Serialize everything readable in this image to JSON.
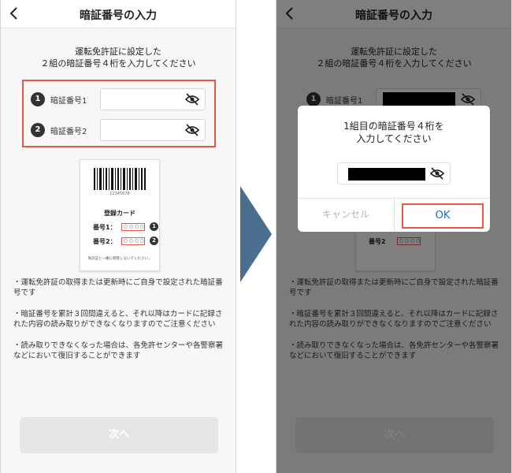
{
  "left": {
    "title": "暗証番号の入力",
    "intro_line1": "運転免許証に設定した",
    "intro_line2": "２組の暗証番号４桁を入力してください",
    "rows": [
      {
        "num": "1",
        "label": "暗証番号1"
      },
      {
        "num": "2",
        "label": "暗証番号2"
      }
    ],
    "card": {
      "barcode_number": "12345678",
      "title": "登録カード",
      "row1_label": "番号1：",
      "row2_label": "番号2：",
      "row1_num": "1",
      "row2_num": "2",
      "note": "免許証と一緒に保管しないでください。"
    },
    "notes": [
      "・運転免許証の取得または更新時にご自身で設定された暗証番号です",
      "・暗証番号を累計３回間違えると、それ以降はカードに記録された内容の読み取りができなくなりますのでご注意ください",
      "・読み取りできなくなった場合は、各免許センターや各警察署などにおいて復旧することができます"
    ],
    "next_label": "次へ"
  },
  "right": {
    "title": "暗証番号の入力",
    "intro_line1": "運転免許証に設定した",
    "intro_line2": "２組の暗証番号４桁を入力してください",
    "row1_num": "1",
    "row1_label": "暗証番号1",
    "row2_label": "番号2",
    "notes": [
      "・運転免許証の取得または更新時にご自身で設定された暗証番号です",
      "・暗証番号を累計３回間違えると、それ以降はカードに記録された内容の読み取りができなくなりますのでご注意ください",
      "・読み取りできなくなった場合は、各免許センターや各警察署などにおいて復旧することができます"
    ],
    "next_label": "次へ",
    "dialog": {
      "line1": "1組目の暗証番号４桁を",
      "line2": "入力してください",
      "cancel": "キャンセル",
      "ok": "OK"
    }
  },
  "colors": {
    "highlight": "#e05a4a",
    "arrow": "#4b6e8f",
    "ok_text": "#1e6bb8",
    "overlay": "rgba(0,0,0,0.5)"
  },
  "icons": [
    "back-chevron-icon",
    "eye-slash-icon",
    "barcode-icon",
    "step-arrow-icon"
  ]
}
